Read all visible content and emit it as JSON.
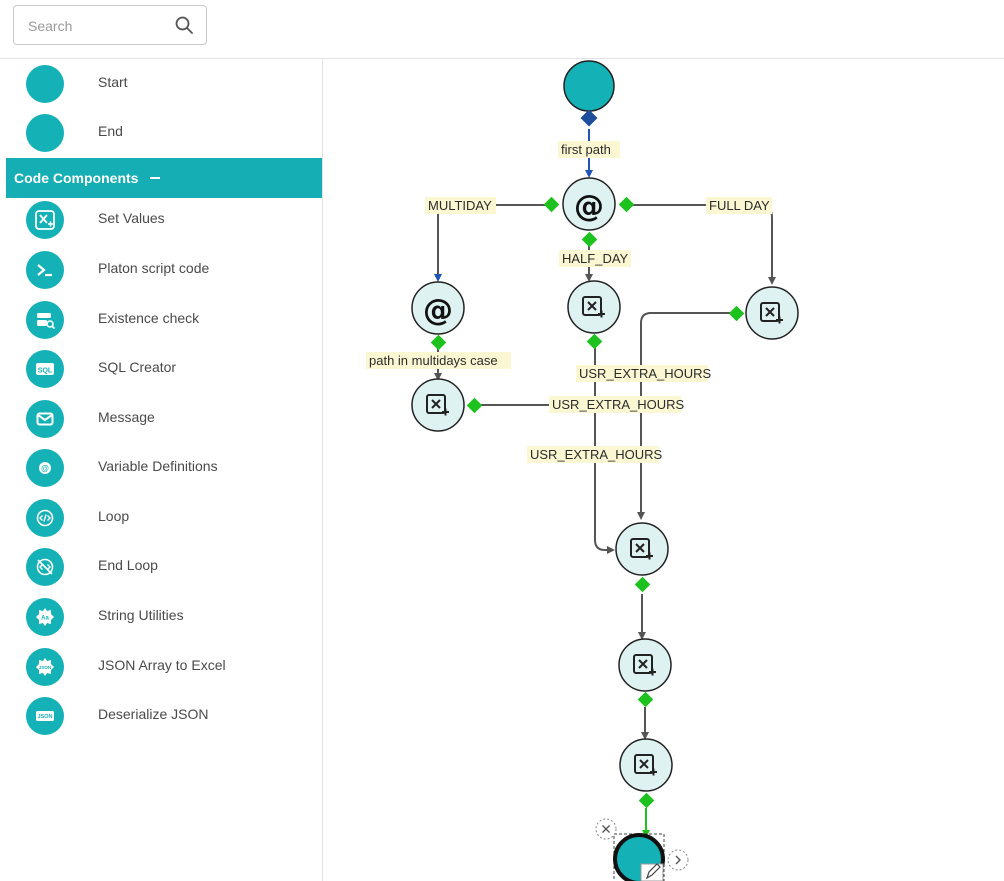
{
  "search": {
    "placeholder": "Search"
  },
  "palette": {
    "basic_items": [
      {
        "label": "Start",
        "icon": "start-circle-icon"
      },
      {
        "label": "End",
        "icon": "end-circle-icon"
      }
    ],
    "section_title": "Code Components",
    "section_toggle": "collapse-minus-icon",
    "code_items": [
      {
        "label": "Set Values",
        "icon": "set-values-icon"
      },
      {
        "label": "Platon script code",
        "icon": "terminal-icon"
      },
      {
        "label": "Existence check",
        "icon": "existence-check-icon"
      },
      {
        "label": "SQL Creator",
        "icon": "sql-icon"
      },
      {
        "label": "Message",
        "icon": "envelope-icon"
      },
      {
        "label": "Variable Definitions",
        "icon": "variable-icon"
      },
      {
        "label": "Loop",
        "icon": "loop-code-icon"
      },
      {
        "label": "End Loop",
        "icon": "end-loop-icon"
      },
      {
        "label": "String Utilities",
        "icon": "string-utilities-icon"
      },
      {
        "label": "JSON Array to Excel",
        "icon": "json-excel-icon"
      },
      {
        "label": "Deserialize JSON",
        "icon": "json-icon"
      }
    ]
  },
  "flow": {
    "nodes": [
      {
        "id": "start",
        "kind": "start"
      },
      {
        "id": "decision-main",
        "kind": "decision"
      },
      {
        "id": "decision-multiday",
        "kind": "decision"
      },
      {
        "id": "set-values-half",
        "kind": "set-values"
      },
      {
        "id": "set-values-full",
        "kind": "set-values"
      },
      {
        "id": "set-values-multi",
        "kind": "set-values"
      },
      {
        "id": "set-values-merge",
        "kind": "set-values"
      },
      {
        "id": "set-values-2",
        "kind": "set-values"
      },
      {
        "id": "set-values-3",
        "kind": "set-values"
      },
      {
        "id": "end",
        "kind": "end"
      }
    ],
    "labels": {
      "first_path": "first path",
      "multiday": "MULTIDAY",
      "full_day": "FULL DAY",
      "half_day": "HALF_DAY",
      "path_in_multidays": "path in multidays case",
      "extra_hours_1": "USR_EXTRA_HOURS",
      "extra_hours_2": "USR_EXTRA_HOURS",
      "extra_hours_3": "USR_EXTRA_HOURS"
    },
    "colors": {
      "node_teal": "#14b1b7",
      "node_light": "#dff2f2",
      "port_green": "#1ec21e",
      "port_blue": "#1c4e9c",
      "edge_gray": "#555555",
      "edge_blue": "#2155b5",
      "label_bg": "#fbf7d2"
    }
  }
}
